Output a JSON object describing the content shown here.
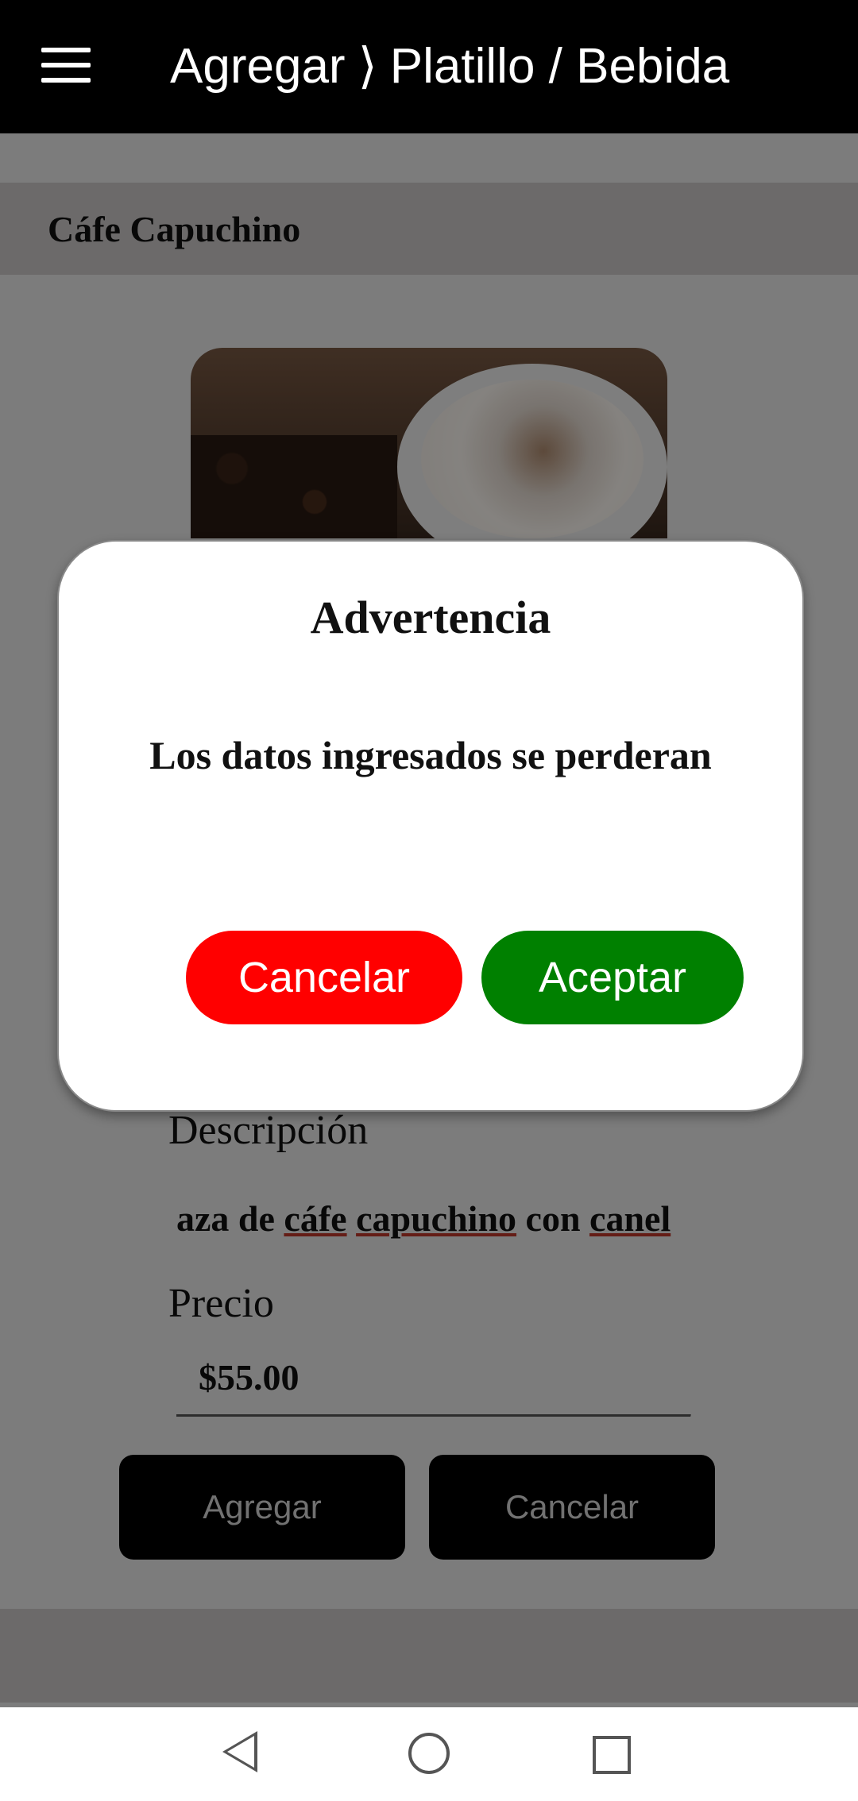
{
  "topbar": {
    "breadcrumb": [
      "Agregar",
      "⟩",
      "Platillo / Bebida"
    ],
    "menu_icon": "hamburger-menu-icon"
  },
  "item": {
    "title": "Cáfe Capuchino",
    "image_label": "cafe-capuchino-image"
  },
  "form": {
    "description_label": "Descripción",
    "description_value_segments": [
      "aza de ",
      "cáfe",
      " ",
      "capuchino",
      " con ",
      "canel"
    ],
    "price_label": "Precio",
    "price_value": "$55.00",
    "add_button": "Agregar",
    "cancel_button": "Cancelar"
  },
  "dialog": {
    "title": "Advertencia",
    "message": "Los datos ingresados se perderan",
    "cancel_button": "Cancelar",
    "accept_button": "Aceptar",
    "colors": {
      "cancel": "#ff0000",
      "accept": "#008000"
    }
  },
  "navbar": {
    "icons": [
      "back-icon",
      "home-icon",
      "recent-apps-icon"
    ]
  }
}
